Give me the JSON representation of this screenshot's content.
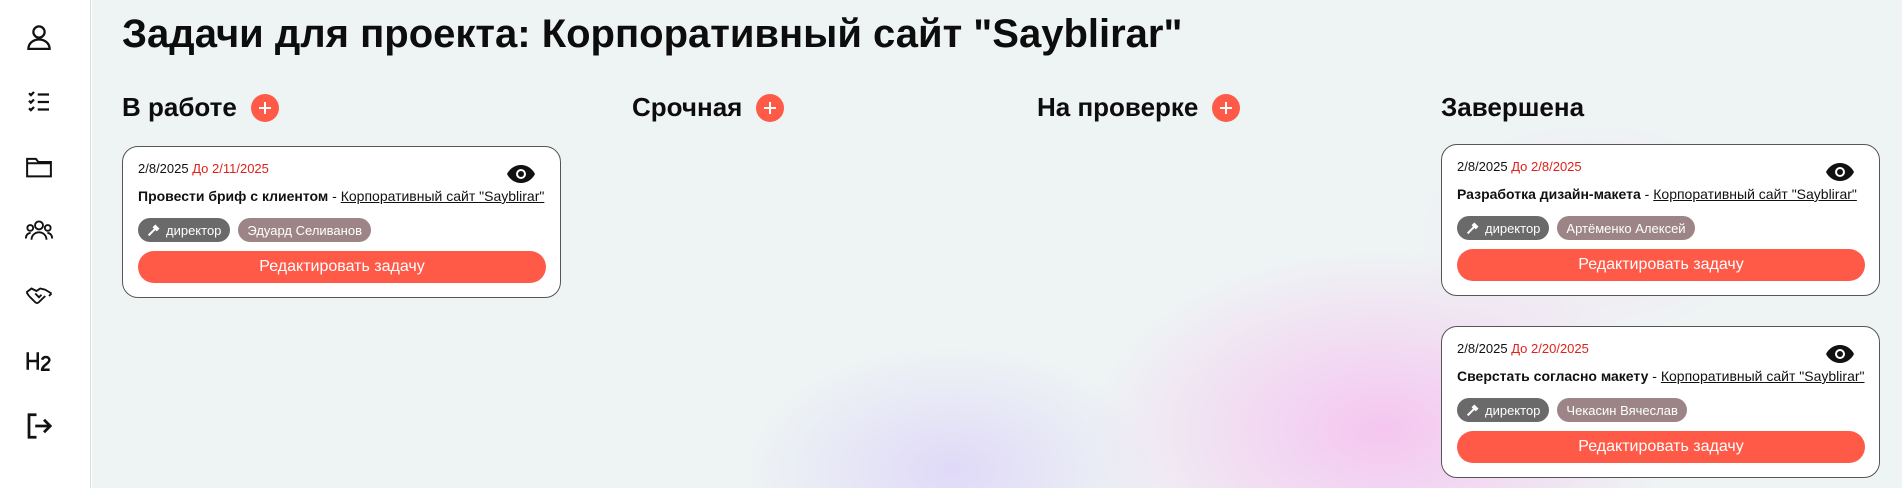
{
  "sidebar": {
    "items": [
      {
        "icon": "user-icon"
      },
      {
        "icon": "checklist-icon"
      },
      {
        "icon": "folder-icon"
      },
      {
        "icon": "team-icon"
      },
      {
        "icon": "handshake-icon"
      },
      {
        "icon": "h2-icon"
      },
      {
        "icon": "logout-icon"
      }
    ]
  },
  "page": {
    "title": "Задачи для проекта: Корпоративный сайт \"Sayblirar\""
  },
  "columns": [
    {
      "title": "В работе",
      "has_add": true
    },
    {
      "title": "Срочная",
      "has_add": true
    },
    {
      "title": "На проверке",
      "has_add": true
    },
    {
      "title": "Завершена",
      "has_add": false
    }
  ],
  "cards": [
    {
      "column": "В работе",
      "created": "2/8/2025",
      "due": "До 2/11/2025",
      "task": "Провести бриф с клиентом",
      "separator": " - ",
      "project": "Корпоративный сайт \"Sayblirar\"",
      "role": "директор",
      "assignee": "Эдуард Селиванов",
      "edit_label": "Редактировать задачу"
    },
    {
      "column": "Завершена",
      "created": "2/8/2025",
      "due": "До 2/8/2025",
      "task": "Разработка дизайн-макета",
      "separator": " - ",
      "project": "Корпоративный сайт \"Sayblirar\"",
      "role": "директор",
      "assignee": "Артёменко Алексей",
      "edit_label": "Редактировать задачу"
    },
    {
      "column": "Завершена",
      "created": "2/8/2025",
      "due": "До 2/20/2025",
      "task": "Сверстать согласно макету",
      "separator": " - ",
      "project": "Корпоративный сайт \"Sayblirar\"",
      "role": "директор",
      "assignee": "Чекасин Вячеслав",
      "edit_label": "Редактировать задачу"
    }
  ],
  "colors": {
    "accent": "#ff5a48",
    "due_text": "#e0211b",
    "role_tag": "#6a6a6a",
    "person_tag": "#9d8587"
  }
}
